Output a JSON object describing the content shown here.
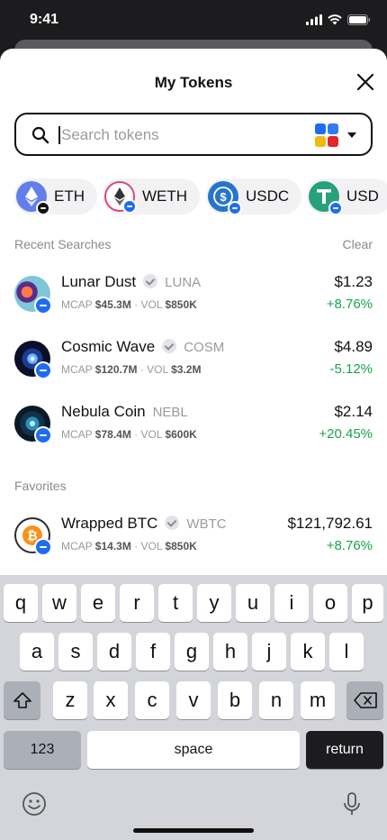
{
  "status_bar": {
    "time": "9:41"
  },
  "sheet": {
    "title": "My Tokens"
  },
  "search": {
    "placeholder": "Search tokens",
    "value": ""
  },
  "chips": [
    {
      "label": "ETH",
      "icon": "eth-icon"
    },
    {
      "label": "WETH",
      "icon": "weth-icon"
    },
    {
      "label": "USDC",
      "icon": "usdc-icon"
    },
    {
      "label": "USD",
      "icon": "usdt-icon"
    }
  ],
  "recent": {
    "label": "Recent Searches",
    "clear": "Clear",
    "items": [
      {
        "name": "Lunar Dust",
        "symbol": "LUNA",
        "mcap_label": "MCAP",
        "mcap": "$45.3M",
        "vol_label": "VOL",
        "vol": "$850K",
        "price": "$1.23",
        "change": "+8.76%"
      },
      {
        "name": "Cosmic Wave",
        "symbol": "COSM",
        "mcap_label": "MCAP",
        "mcap": "$120.7M",
        "vol_label": "VOL",
        "vol": "$3.2M",
        "price": "$4.89",
        "change": "-5.12%"
      },
      {
        "name": "Nebula Coin",
        "symbol": "NEBL",
        "mcap_label": "MCAP",
        "mcap": "$78.4M",
        "vol_label": "VOL",
        "vol": "$600K",
        "price": "$2.14",
        "change": "+20.45%"
      }
    ]
  },
  "favorites": {
    "label": "Favorites",
    "items": [
      {
        "name": "Wrapped BTC",
        "symbol": "WBTC",
        "mcap_label": "MCAP",
        "mcap": "$14.3M",
        "vol_label": "VOL",
        "vol": "$850K",
        "price": "$121,792.61",
        "change": "+8.76%"
      }
    ]
  },
  "keyboard": {
    "row1": [
      "q",
      "w",
      "e",
      "r",
      "t",
      "y",
      "u",
      "i",
      "o",
      "p"
    ],
    "row2": [
      "a",
      "s",
      "d",
      "f",
      "g",
      "h",
      "j",
      "k",
      "l"
    ],
    "row3": [
      "z",
      "x",
      "c",
      "v",
      "b",
      "n",
      "m"
    ],
    "numbers": "123",
    "space": "space",
    "return": "return"
  },
  "colors": {
    "positive": "#1aa34a",
    "accent": "#1f6cf2"
  }
}
